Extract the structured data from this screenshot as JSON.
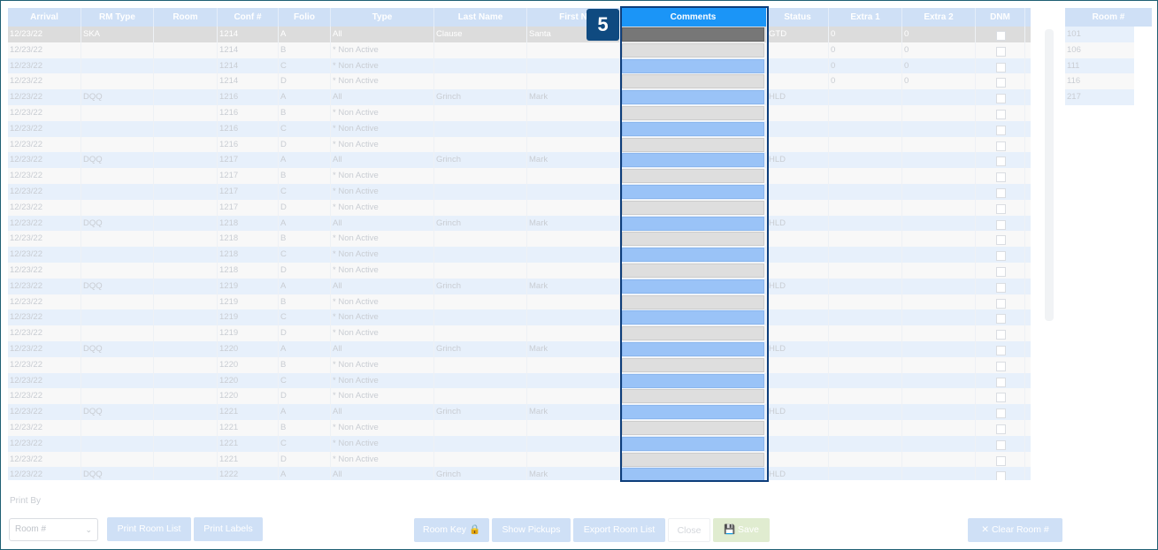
{
  "headers": {
    "arrival": "Arrival",
    "rm_type": "RM Type",
    "room": "Room",
    "conf": "Conf #",
    "folio": "Folio",
    "type": "Type",
    "last_name": "Last Name",
    "first_name": "First N",
    "comments": "Comments",
    "status": "Status",
    "extra1": "Extra 1",
    "extra2": "Extra 2",
    "dnm": "DNM"
  },
  "rows": [
    {
      "arrival": "12/23/22",
      "rm_type": "SKA",
      "room": "",
      "conf": "1214",
      "folio": "A",
      "type": "All",
      "last": "Clause",
      "first": "Santa",
      "status": "GTD",
      "extra1": "0",
      "extra2": "0"
    },
    {
      "arrival": "12/23/22",
      "rm_type": "",
      "room": "",
      "conf": "1214",
      "folio": "B",
      "type": "* Non Active",
      "last": "",
      "first": "",
      "status": "",
      "extra1": "0",
      "extra2": "0"
    },
    {
      "arrival": "12/23/22",
      "rm_type": "",
      "room": "",
      "conf": "1214",
      "folio": "C",
      "type": "* Non Active",
      "last": "",
      "first": "",
      "status": "",
      "extra1": "0",
      "extra2": "0"
    },
    {
      "arrival": "12/23/22",
      "rm_type": "",
      "room": "",
      "conf": "1214",
      "folio": "D",
      "type": "* Non Active",
      "last": "",
      "first": "",
      "status": "",
      "extra1": "0",
      "extra2": "0"
    },
    {
      "arrival": "12/23/22",
      "rm_type": "DQQ",
      "room": "",
      "conf": "1216",
      "folio": "A",
      "type": "All",
      "last": "Grinch",
      "first": "Mark",
      "status": "HLD",
      "extra1": "",
      "extra2": ""
    },
    {
      "arrival": "12/23/22",
      "rm_type": "",
      "room": "",
      "conf": "1216",
      "folio": "B",
      "type": "* Non Active",
      "last": "",
      "first": "",
      "status": "",
      "extra1": "",
      "extra2": ""
    },
    {
      "arrival": "12/23/22",
      "rm_type": "",
      "room": "",
      "conf": "1216",
      "folio": "C",
      "type": "* Non Active",
      "last": "",
      "first": "",
      "status": "",
      "extra1": "",
      "extra2": ""
    },
    {
      "arrival": "12/23/22",
      "rm_type": "",
      "room": "",
      "conf": "1216",
      "folio": "D",
      "type": "* Non Active",
      "last": "",
      "first": "",
      "status": "",
      "extra1": "",
      "extra2": ""
    },
    {
      "arrival": "12/23/22",
      "rm_type": "DQQ",
      "room": "",
      "conf": "1217",
      "folio": "A",
      "type": "All",
      "last": "Grinch",
      "first": "Mark",
      "status": "HLD",
      "extra1": "",
      "extra2": ""
    },
    {
      "arrival": "12/23/22",
      "rm_type": "",
      "room": "",
      "conf": "1217",
      "folio": "B",
      "type": "* Non Active",
      "last": "",
      "first": "",
      "status": "",
      "extra1": "",
      "extra2": ""
    },
    {
      "arrival": "12/23/22",
      "rm_type": "",
      "room": "",
      "conf": "1217",
      "folio": "C",
      "type": "* Non Active",
      "last": "",
      "first": "",
      "status": "",
      "extra1": "",
      "extra2": ""
    },
    {
      "arrival": "12/23/22",
      "rm_type": "",
      "room": "",
      "conf": "1217",
      "folio": "D",
      "type": "* Non Active",
      "last": "",
      "first": "",
      "status": "",
      "extra1": "",
      "extra2": ""
    },
    {
      "arrival": "12/23/22",
      "rm_type": "DQQ",
      "room": "",
      "conf": "1218",
      "folio": "A",
      "type": "All",
      "last": "Grinch",
      "first": "Mark",
      "status": "HLD",
      "extra1": "",
      "extra2": ""
    },
    {
      "arrival": "12/23/22",
      "rm_type": "",
      "room": "",
      "conf": "1218",
      "folio": "B",
      "type": "* Non Active",
      "last": "",
      "first": "",
      "status": "",
      "extra1": "",
      "extra2": ""
    },
    {
      "arrival": "12/23/22",
      "rm_type": "",
      "room": "",
      "conf": "1218",
      "folio": "C",
      "type": "* Non Active",
      "last": "",
      "first": "",
      "status": "",
      "extra1": "",
      "extra2": ""
    },
    {
      "arrival": "12/23/22",
      "rm_type": "",
      "room": "",
      "conf": "1218",
      "folio": "D",
      "type": "* Non Active",
      "last": "",
      "first": "",
      "status": "",
      "extra1": "",
      "extra2": ""
    },
    {
      "arrival": "12/23/22",
      "rm_type": "DQQ",
      "room": "",
      "conf": "1219",
      "folio": "A",
      "type": "All",
      "last": "Grinch",
      "first": "Mark",
      "status": "HLD",
      "extra1": "",
      "extra2": ""
    },
    {
      "arrival": "12/23/22",
      "rm_type": "",
      "room": "",
      "conf": "1219",
      "folio": "B",
      "type": "* Non Active",
      "last": "",
      "first": "",
      "status": "",
      "extra1": "",
      "extra2": ""
    },
    {
      "arrival": "12/23/22",
      "rm_type": "",
      "room": "",
      "conf": "1219",
      "folio": "C",
      "type": "* Non Active",
      "last": "",
      "first": "",
      "status": "",
      "extra1": "",
      "extra2": ""
    },
    {
      "arrival": "12/23/22",
      "rm_type": "",
      "room": "",
      "conf": "1219",
      "folio": "D",
      "type": "* Non Active",
      "last": "",
      "first": "",
      "status": "",
      "extra1": "",
      "extra2": ""
    },
    {
      "arrival": "12/23/22",
      "rm_type": "DQQ",
      "room": "",
      "conf": "1220",
      "folio": "A",
      "type": "All",
      "last": "Grinch",
      "first": "Mark",
      "status": "HLD",
      "extra1": "",
      "extra2": ""
    },
    {
      "arrival": "12/23/22",
      "rm_type": "",
      "room": "",
      "conf": "1220",
      "folio": "B",
      "type": "* Non Active",
      "last": "",
      "first": "",
      "status": "",
      "extra1": "",
      "extra2": ""
    },
    {
      "arrival": "12/23/22",
      "rm_type": "",
      "room": "",
      "conf": "1220",
      "folio": "C",
      "type": "* Non Active",
      "last": "",
      "first": "",
      "status": "",
      "extra1": "",
      "extra2": ""
    },
    {
      "arrival": "12/23/22",
      "rm_type": "",
      "room": "",
      "conf": "1220",
      "folio": "D",
      "type": "* Non Active",
      "last": "",
      "first": "",
      "status": "",
      "extra1": "",
      "extra2": ""
    },
    {
      "arrival": "12/23/22",
      "rm_type": "DQQ",
      "room": "",
      "conf": "1221",
      "folio": "A",
      "type": "All",
      "last": "Grinch",
      "first": "Mark",
      "status": "HLD",
      "extra1": "",
      "extra2": ""
    },
    {
      "arrival": "12/23/22",
      "rm_type": "",
      "room": "",
      "conf": "1221",
      "folio": "B",
      "type": "* Non Active",
      "last": "",
      "first": "",
      "status": "",
      "extra1": "",
      "extra2": ""
    },
    {
      "arrival": "12/23/22",
      "rm_type": "",
      "room": "",
      "conf": "1221",
      "folio": "C",
      "type": "* Non Active",
      "last": "",
      "first": "",
      "status": "",
      "extra1": "",
      "extra2": ""
    },
    {
      "arrival": "12/23/22",
      "rm_type": "",
      "room": "",
      "conf": "1221",
      "folio": "D",
      "type": "* Non Active",
      "last": "",
      "first": "",
      "status": "",
      "extra1": "",
      "extra2": ""
    },
    {
      "arrival": "12/23/22",
      "rm_type": "DQQ",
      "room": "",
      "conf": "1222",
      "folio": "A",
      "type": "All",
      "last": "Grinch",
      "first": "Mark",
      "status": "HLD",
      "extra1": "",
      "extra2": ""
    }
  ],
  "room_panel": {
    "header": "Room #",
    "rooms": [
      "101",
      "106",
      "111",
      "116",
      "217"
    ]
  },
  "step_badge": "5",
  "footer": {
    "print_by_label": "Print By",
    "print_by_selected": "Room #",
    "print_room_list": "Print Room List",
    "print_labels": "Print Labels",
    "room_key": "Room Key",
    "show_pickups": "Show Pickups",
    "export_room_list": "Export Room List",
    "close": "Close",
    "save": "Save",
    "clear_room": "Clear Room #"
  },
  "colors": {
    "header_bg": "#cfe0f6",
    "comments_header_bg": "#1b95f7",
    "highlight_border": "#0d3d7a",
    "badge_bg": "#0f4a80",
    "comment_cell_blue": "#9ac3f7",
    "comment_cell_gray": "#dedede"
  }
}
